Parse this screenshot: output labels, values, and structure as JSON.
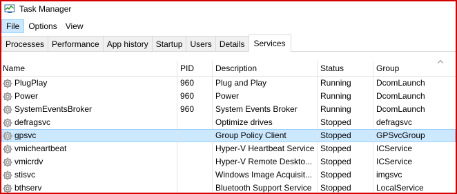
{
  "window": {
    "title": "Task Manager"
  },
  "menu": [
    "File",
    "Options",
    "View"
  ],
  "tabs": [
    "Processes",
    "Performance",
    "App history",
    "Startup",
    "Users",
    "Details",
    "Services"
  ],
  "active_tab": "Services",
  "columns": {
    "name": "Name",
    "pid": "PID",
    "description": "Description",
    "status": "Status",
    "group": "Group"
  },
  "services": [
    {
      "name": "PlugPlay",
      "pid": "960",
      "description": "Plug and Play",
      "status": "Running",
      "group": "DcomLaunch"
    },
    {
      "name": "Power",
      "pid": "960",
      "description": "Power",
      "status": "Running",
      "group": "DcomLaunch"
    },
    {
      "name": "SystemEventsBroker",
      "pid": "960",
      "description": "System Events Broker",
      "status": "Running",
      "group": "DcomLaunch"
    },
    {
      "name": "defragsvc",
      "pid": "",
      "description": "Optimize drives",
      "status": "Stopped",
      "group": "defragsvc"
    },
    {
      "name": "gpsvc",
      "pid": "",
      "description": "Group Policy Client",
      "status": "Stopped",
      "group": "GPSvcGroup",
      "selected": true
    },
    {
      "name": "vmicheartbeat",
      "pid": "",
      "description": "Hyper-V Heartbeat Service",
      "status": "Stopped",
      "group": "ICService"
    },
    {
      "name": "vmicrdv",
      "pid": "",
      "description": "Hyper-V Remote Deskto...",
      "status": "Stopped",
      "group": "ICService"
    },
    {
      "name": "stisvc",
      "pid": "",
      "description": "Windows Image Acquisit...",
      "status": "Stopped",
      "group": "imgsvc"
    },
    {
      "name": "bthserv",
      "pid": "",
      "description": "Bluetooth Support Service",
      "status": "Stopped",
      "group": "LocalService"
    }
  ],
  "icons": {
    "title": "task-manager-icon",
    "row": "gear-icon",
    "sort": "chevron-up-icon"
  },
  "colors": {
    "frame_border": "#d40000",
    "selection": "#cce8ff",
    "selection_border": "#99d1ff"
  }
}
